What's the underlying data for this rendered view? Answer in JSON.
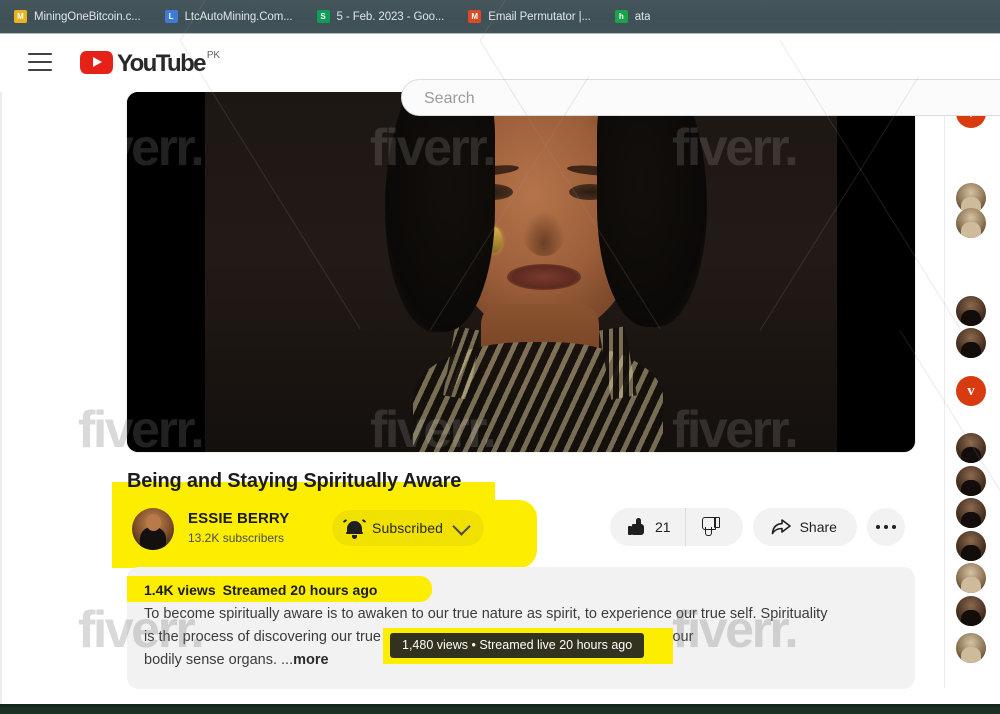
{
  "browser": {
    "tabs": [
      {
        "title": "MiningOneBitcoin.c...",
        "favicon_label": "M",
        "favicon_color": "#e8b31f"
      },
      {
        "title": "LtcAutoMining.Com...",
        "favicon_label": "L",
        "favicon_color": "#3f7bd6"
      },
      {
        "title": "5 - Feb. 2023 - Goo...",
        "favicon_label": "S",
        "favicon_color": "#0f9d58"
      },
      {
        "title": "Email Permutator |...",
        "favicon_label": "M",
        "favicon_color": "#d94a28"
      },
      {
        "title": "ata",
        "favicon_label": "h",
        "favicon_color": "#1aa34a"
      }
    ]
  },
  "masthead": {
    "menu_label": "Guide",
    "logo_text": "YouTube",
    "country_code": "PK",
    "search_placeholder": "Search",
    "search_value": ""
  },
  "video": {
    "title": "Being and Staying Spiritually Aware",
    "channel_name": "ESSIE BERRY",
    "subscriber_count": "13.2K subscribers",
    "subscribe_label": "Subscribed",
    "like_count": "21",
    "share_label": "Share",
    "views": "1.4K views",
    "streamed": "Streamed 20 hours ago",
    "description_line1": "To become spiritually aware is to awaken to our true nature as spirit, to experience our true self. Spirituality",
    "description_line2": "is the process of discovering our true self. This realization is possible only through our",
    "description_line3": "bodily sense organs. ...",
    "more_label": "more",
    "tooltip": "1,480 views • Streamed live 20 hours ago",
    "watermark": "fiverr."
  },
  "rail": {
    "items": [
      {
        "type": "brand",
        "label": "v"
      },
      {
        "type": "photo",
        "tone": "light"
      },
      {
        "type": "photo",
        "tone": "light"
      },
      {
        "type": "photo",
        "tone": "dark"
      },
      {
        "type": "photo",
        "tone": "dark"
      },
      {
        "type": "brand",
        "label": "v"
      },
      {
        "type": "photo",
        "tone": "dark"
      },
      {
        "type": "photo",
        "tone": "dark"
      },
      {
        "type": "photo",
        "tone": "dark"
      },
      {
        "type": "photo",
        "tone": "dark"
      },
      {
        "type": "photo",
        "tone": "light"
      },
      {
        "type": "photo",
        "tone": "dark"
      },
      {
        "type": "photo",
        "tone": "light"
      }
    ]
  },
  "colors": {
    "youtube_red": "#e62117",
    "highlight_yellow": "#fdee00",
    "tab_strip": "#415359",
    "card_gray": "#f2f2f2"
  }
}
